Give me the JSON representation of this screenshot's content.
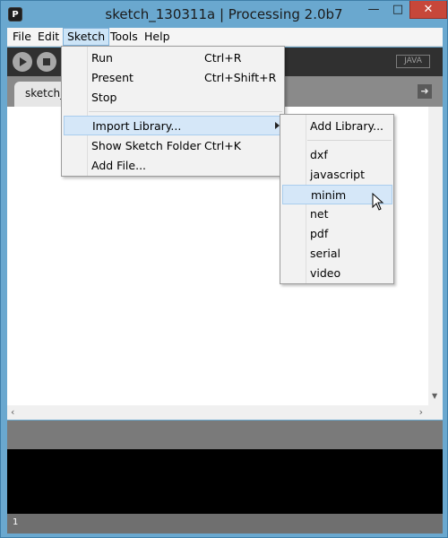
{
  "window": {
    "title": "sketch_130311a | Processing 2.0b7",
    "app_icon": "P",
    "colors": {
      "frame": "#6aa8cf",
      "close": "#c7473a",
      "menu_highlight": "#cce4f7"
    }
  },
  "menubar": {
    "items": [
      {
        "label": "File"
      },
      {
        "label": "Edit"
      },
      {
        "label": "Sketch",
        "active": true
      },
      {
        "label": "Tools"
      },
      {
        "label": "Help"
      }
    ]
  },
  "toolbar": {
    "icons": [
      "play-icon",
      "stop-icon"
    ],
    "mode": "JAVA"
  },
  "tabs": {
    "current": "sketch_130311a"
  },
  "sketch_menu": {
    "items": [
      {
        "label": "Run",
        "shortcut": "Ctrl+R"
      },
      {
        "label": "Present",
        "shortcut": "Ctrl+Shift+R"
      },
      {
        "label": "Stop",
        "shortcut": ""
      },
      {
        "label": "Import Library...",
        "shortcut": "",
        "has_submenu": true,
        "highlighted": true
      },
      {
        "label": "Show Sketch Folder",
        "shortcut": "Ctrl+K"
      },
      {
        "label": "Add File...",
        "shortcut": ""
      }
    ]
  },
  "library_submenu": {
    "items": [
      {
        "label": "Add Library..."
      },
      {
        "label": "dxf"
      },
      {
        "label": "javascript"
      },
      {
        "label": "minim",
        "highlighted": true
      },
      {
        "label": "net"
      },
      {
        "label": "pdf"
      },
      {
        "label": "serial"
      },
      {
        "label": "video"
      }
    ]
  },
  "status": {
    "line_number": "1"
  }
}
